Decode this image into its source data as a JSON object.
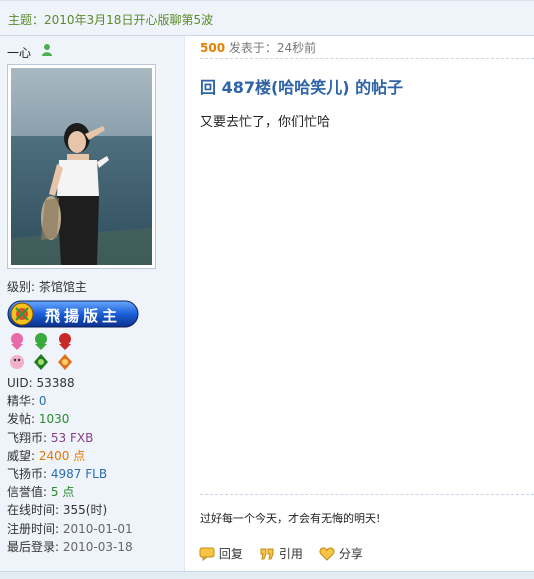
{
  "topic": {
    "subject": "主题：2010年3月18日开心版聊第5波"
  },
  "author": {
    "name": "一心",
    "level_label": "级别:",
    "level_value": "茶馆馆主",
    "banner_text": "飛揚版主",
    "stats": [
      {
        "label": "UID:",
        "value": "53388",
        "color": "#333333"
      },
      {
        "label": "精华:",
        "value": "0",
        "color": "#2b6cb0"
      },
      {
        "label": "发帖:",
        "value": "1030",
        "color": "#2a8a2a"
      },
      {
        "label": "飞翔币:",
        "value": "53 FXB",
        "color": "#8b3c8b"
      },
      {
        "label": "威望:",
        "value": "2400 点",
        "color": "#e07a00"
      },
      {
        "label": "飞扬币:",
        "value": "4987 FLB",
        "color": "#2b6cb0"
      },
      {
        "label": "信誉值:",
        "value": "5 点",
        "color": "#2a8a2a"
      },
      {
        "label": "在线时间:",
        "value": "355(时)",
        "color": "#333333"
      },
      {
        "label": "注册时间:",
        "value": "2010-01-01",
        "color": "#777777"
      },
      {
        "label": "最后登录:",
        "value": "2010-03-18",
        "color": "#777777"
      }
    ]
  },
  "post": {
    "floor": "500",
    "posted_at": "发表于：24秒前",
    "title": "回 487楼(哈哈笑儿) 的帖子",
    "body": "又要去忙了，你们忙哈",
    "signature": "过好每一个今天，才会有无悔的明天!"
  },
  "actions": {
    "reply": "回复",
    "quote": "引用",
    "share": "分享"
  },
  "colors": {
    "accent": "#2e63a8",
    "floor": "#e67e00",
    "sidebar_bg": "#eef4fa",
    "subject": "#5a8a2a"
  }
}
